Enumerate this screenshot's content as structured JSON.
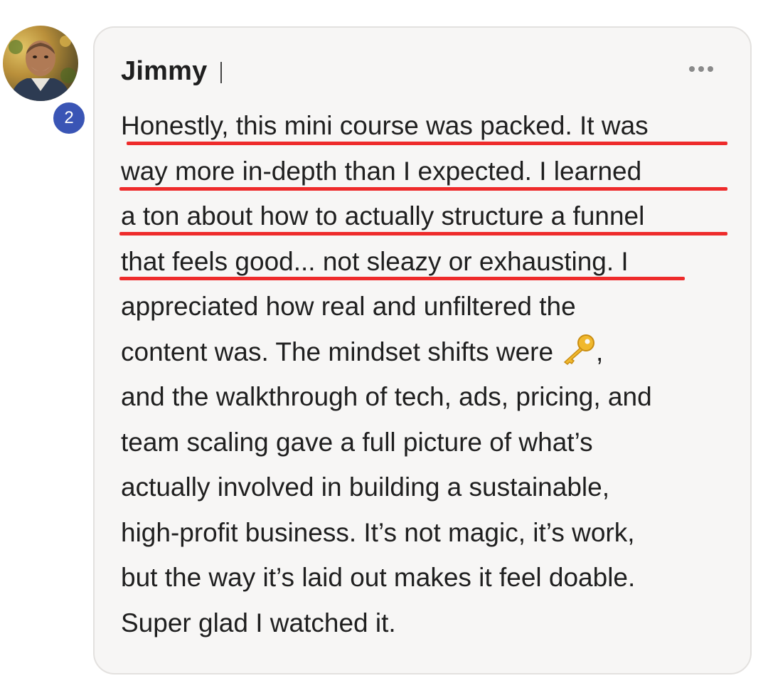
{
  "comment": {
    "author": "Jimmy",
    "badge_count": "2",
    "more_icon": "more-horizontal-icon",
    "lines": [
      "Honestly, this mini course was packed. It was",
      "way more in-depth than I expected. I learned",
      "a ton about how to actually structure a funnel",
      "that feels good... not sleazy or exhausting. I",
      "appreciated how real and unfiltered the",
      "content was. The mindset shifts were",
      "and the walkthrough of tech, ads, pricing, and",
      "team scaling gave a full picture of what’s",
      "actually involved in building a sustainable,",
      "high-profit business. It’s not magic, it’s work,",
      "but the way it’s laid out makes it feel doable.",
      "Super glad I watched it."
    ],
    "line6_suffix": ",",
    "emoji": "key-emoji-icon",
    "highlight_color": "#ee2b2b",
    "badge_color": "#3a55b5"
  }
}
